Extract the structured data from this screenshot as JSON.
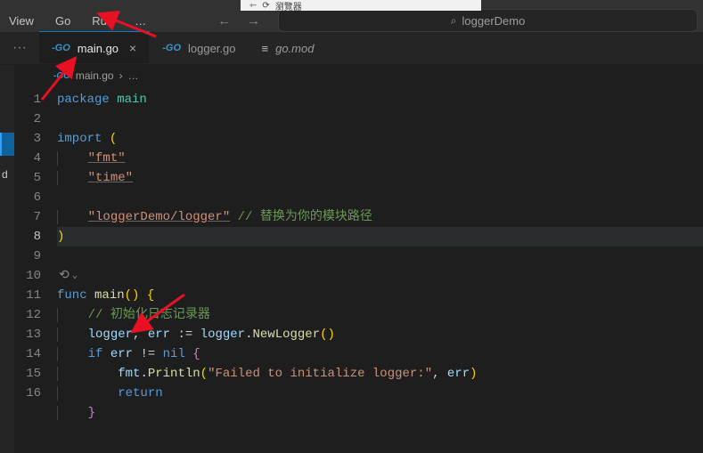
{
  "topstrip": {
    "text": "瀏覽器"
  },
  "menu": {
    "view": "View",
    "go": "Go",
    "run": "Run",
    "more": "…"
  },
  "nav": {
    "back": "←",
    "forward": "→"
  },
  "search": {
    "icon": "⌕",
    "value": "loggerDemo"
  },
  "tabs": {
    "items": [
      {
        "icon": "-GO",
        "label": "main.go",
        "active": true,
        "close": "×"
      },
      {
        "icon": "-GO",
        "label": "logger.go",
        "active": false
      },
      {
        "icon": "≡",
        "label": "go.mod",
        "active": false,
        "italic": true
      }
    ]
  },
  "leftstrip": {
    "d": "d"
  },
  "breadcrumb": {
    "icon": "-GO",
    "file": "main.go",
    "sep": "›",
    "more": "…"
  },
  "code": {
    "lines": [
      {
        "n": 1,
        "segs": [
          [
            "package ",
            "kw"
          ],
          [
            "main",
            "pkg"
          ]
        ]
      },
      {
        "n": 2,
        "segs": []
      },
      {
        "n": 3,
        "segs": [
          [
            "import ",
            "kw"
          ],
          [
            "(",
            "par"
          ]
        ]
      },
      {
        "n": 4,
        "indent": 1,
        "segs": [
          [
            "\"fmt\"",
            "str-u"
          ]
        ]
      },
      {
        "n": 5,
        "indent": 1,
        "segs": [
          [
            "\"time\"",
            "str-u"
          ]
        ]
      },
      {
        "n": 6,
        "segs": []
      },
      {
        "n": 7,
        "indent": 1,
        "segs": [
          [
            "\"loggerDemo/logger\"",
            "str-u"
          ],
          [
            " ",
            ""
          ],
          [
            "// 替换为你的模块路径",
            "cmt"
          ]
        ]
      },
      {
        "n": 8,
        "hl": true,
        "segs": [
          [
            ")",
            "par"
          ]
        ]
      },
      {
        "n": 9,
        "segs": []
      },
      {
        "n": "",
        "codelens": true,
        "icon": "⟲",
        "chev": "⌄"
      },
      {
        "n": 10,
        "segs": [
          [
            "func ",
            "kw"
          ],
          [
            "main",
            "fn"
          ],
          [
            "() {",
            "par"
          ]
        ]
      },
      {
        "n": 11,
        "indent": 1,
        "segs": [
          [
            "// 初始化日志记录器",
            "cmt"
          ]
        ]
      },
      {
        "n": 12,
        "indent": 1,
        "segs": [
          [
            "logger",
            "id"
          ],
          [
            ", ",
            ""
          ],
          [
            "err",
            "id"
          ],
          [
            " := ",
            ""
          ],
          [
            "logger",
            "id"
          ],
          [
            ".",
            ""
          ],
          [
            "NewLogger",
            "fn"
          ],
          [
            "()",
            "par"
          ]
        ]
      },
      {
        "n": 13,
        "indent": 1,
        "segs": [
          [
            "if ",
            "kw"
          ],
          [
            "err",
            "id"
          ],
          [
            " != ",
            ""
          ],
          [
            "nil ",
            "kw"
          ],
          [
            "{",
            "par2"
          ]
        ]
      },
      {
        "n": 14,
        "indent": 2,
        "segs": [
          [
            "fmt",
            "id"
          ],
          [
            ".",
            ""
          ],
          [
            "Println",
            "fn"
          ],
          [
            "(",
            "par"
          ],
          [
            "\"Failed to initialize logger:\"",
            "str"
          ],
          [
            ", ",
            ""
          ],
          [
            "err",
            "id"
          ],
          [
            ")",
            "par"
          ]
        ]
      },
      {
        "n": 15,
        "indent": 2,
        "segs": [
          [
            "return",
            "kw"
          ]
        ]
      },
      {
        "n": 16,
        "indent": 1,
        "segs": [
          [
            "}",
            "par2"
          ]
        ]
      }
    ]
  }
}
